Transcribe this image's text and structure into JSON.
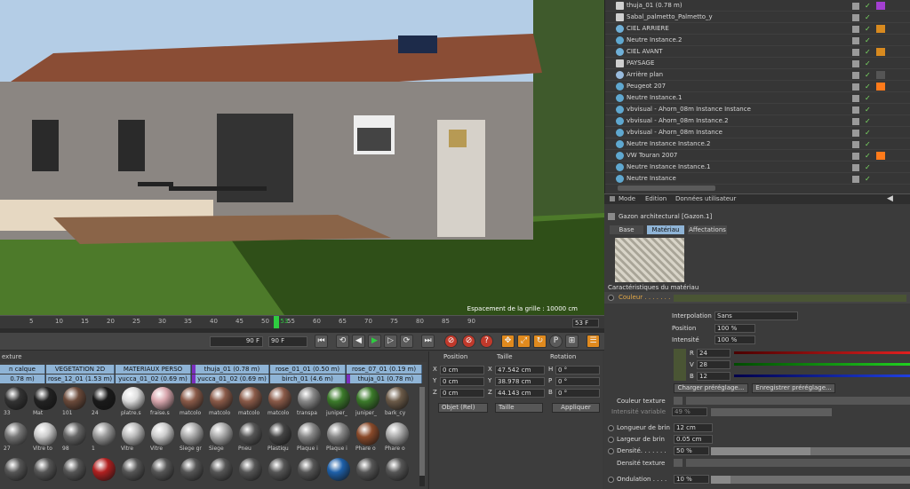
{
  "viewport": {
    "status": "Espacement de la grille : 10000 cm"
  },
  "timeline": {
    "ticks": [
      "5",
      "10",
      "15",
      "20",
      "25",
      "30",
      "35",
      "40",
      "45",
      "50",
      "53",
      "55",
      "60",
      "65",
      "70",
      "75",
      "80",
      "85",
      "90"
    ],
    "frame_box": "53 F"
  },
  "transport": {
    "start": "0 F",
    "end_a": "90 F",
    "end_b": "90 F"
  },
  "materials": {
    "title": "exture",
    "layers_row1": [
      "n calque",
      "VEGETATION 2D",
      "MATERIAUX PERSO",
      "thuja_01 (0.78 m)",
      "rose_01_01 (0.50 m)",
      "rose_07_01 (0.19 m)"
    ],
    "layers_row2": [
      "0.78 m)",
      "rose_12_01 (1.53 m)",
      "yucca_01_02 (0.69 m)",
      "yucca_01_02 (0.69 m)",
      "birch_01 (4.6 m)",
      "thuja_01 (0.78 m)"
    ],
    "row1": [
      "33",
      "Mat",
      "101",
      "24",
      "platre.s",
      "fraise.s",
      "matcolo",
      "matcolo",
      "matcolo",
      "matcolo",
      "transpa",
      "juniper_",
      "juniper_",
      "bark_cy"
    ],
    "row2": [
      "27",
      "Vitre to",
      "98",
      "1",
      "Vitre",
      "Vitre",
      "Siege gr",
      "Siege",
      "Pneu",
      "Plastiqu",
      "Plaque i",
      "Plaque i",
      "Phare o",
      "Phare o"
    ],
    "row3": [
      "",
      "",
      "",
      "",
      "",
      "",
      "",
      "",
      "",
      "",
      "",
      "",
      "",
      ""
    ]
  },
  "coords": {
    "position": "Position",
    "taille": "Taille",
    "rotation": "Rotation",
    "rows": [
      {
        "axis": "X",
        "pos": "0 cm",
        "saxis": "X",
        "size": "47.542 cm",
        "raxis": "H",
        "rot": "0 °"
      },
      {
        "axis": "Y",
        "pos": "0 cm",
        "saxis": "Y",
        "size": "38.978 cm",
        "raxis": "P",
        "rot": "0 °"
      },
      {
        "axis": "Z",
        "pos": "0 cm",
        "saxis": "Z",
        "size": "44.143 cm",
        "raxis": "B",
        "rot": "0 °"
      }
    ],
    "mode": "Objet (Rel)",
    "size_mode": "Taille",
    "apply": "Appliquer"
  },
  "objects": [
    {
      "label": "thuja_01 (0.78 m)",
      "icon": "layer-icon",
      "tag": "#a33fd1"
    },
    {
      "label": "Sabal_palmetto_Palmetto_y",
      "icon": "layer-icon",
      "tag": ""
    },
    {
      "label": "CIEL ARRIERE",
      "icon": "sky-icon",
      "tag": "#d88a1f"
    },
    {
      "label": "Neutre Instance.2",
      "icon": "instance-icon",
      "tag": ""
    },
    {
      "label": "CIEL AVANT",
      "icon": "sky-icon",
      "tag": "#d88a1f"
    },
    {
      "label": "PAYSAGE",
      "icon": "layer-icon",
      "tag": ""
    },
    {
      "label": "Arrière plan",
      "icon": "background-icon",
      "tag": "#555"
    },
    {
      "label": "Peugeot 207",
      "icon": "instance-icon",
      "tag": "#ff7a1a"
    },
    {
      "label": "Neutre Instance.1",
      "icon": "instance-icon",
      "tag": ""
    },
    {
      "label": "vbvisual - Ahorn_08m Instance Instance",
      "icon": "instance-icon",
      "tag": ""
    },
    {
      "label": "vbvisual - Ahorn_08m Instance.2",
      "icon": "instance-icon",
      "tag": ""
    },
    {
      "label": "vbvisual - Ahorn_08m Instance",
      "icon": "instance-icon",
      "tag": ""
    },
    {
      "label": "Neutre Instance Instance.2",
      "icon": "instance-icon",
      "tag": ""
    },
    {
      "label": "VW Touran 2007",
      "icon": "instance-icon",
      "tag": "#ff7a1a"
    },
    {
      "label": "Neutre Instance Instance.1",
      "icon": "instance-icon",
      "tag": ""
    },
    {
      "label": "Neutre Instance",
      "icon": "instance-icon",
      "tag": ""
    }
  ],
  "attr_menu": {
    "mode": "Mode",
    "edit": "Edition",
    "user": "Données utilisateur"
  },
  "attr": {
    "title": "Gazon architectural [Gazon.1]",
    "tabs": [
      "Base",
      "Matériau",
      "Affectations"
    ],
    "section": "Caractéristiques du matériau",
    "couleur": "Couleur . . . . . . .",
    "interp_label": "Interpolation",
    "interp_value": "Sans",
    "position_label": "Position",
    "position_value": "100 %",
    "intensite_label": "Intensité",
    "intensite_value": "100 %",
    "r_label": "R",
    "r_value": "24",
    "v_label": "V",
    "v_value": "28",
    "b_label": "B",
    "b_value": "12",
    "load_preset": "Charger préréglage...",
    "save_preset": "Enregistrer préréglage...",
    "tex_label": "Couleur texture",
    "var_label": "Intensité variable",
    "var_value": "49 %",
    "len_label": "Longueur de brin",
    "len_value": "12 cm",
    "width_label": "Largeur de brin",
    "width_value": "0.05 cm",
    "dens_label": "Densité. . . . . . .",
    "dens_value": "50 %",
    "dens_tex_label": "Densité texture",
    "ond_label": "Ondulation . . . .",
    "ond_value": "10 %"
  }
}
